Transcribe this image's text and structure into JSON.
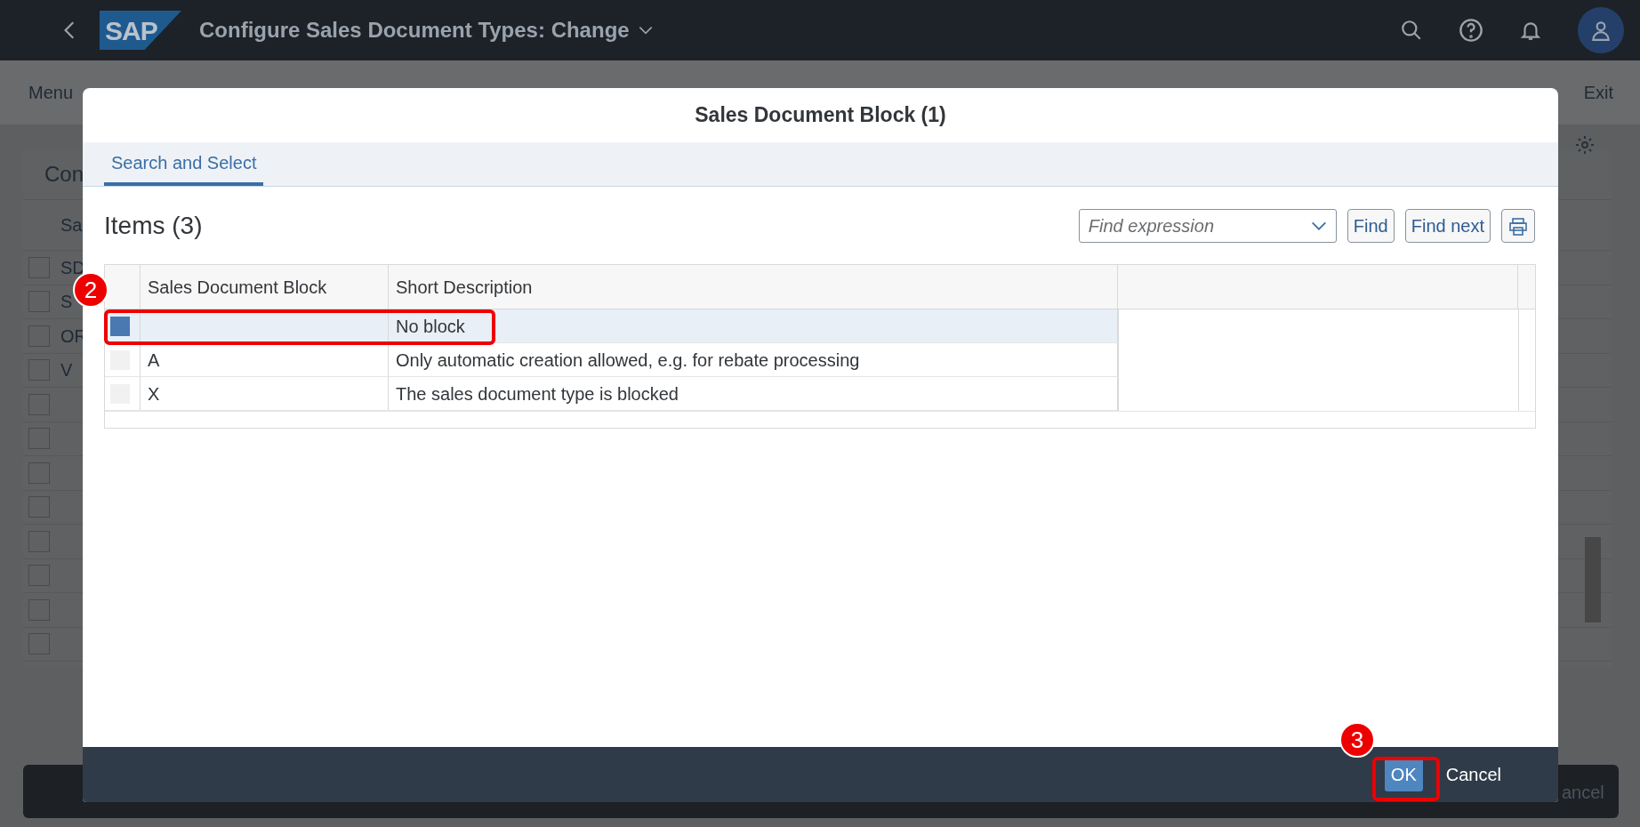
{
  "shell": {
    "logo": "SAP",
    "title": "Configure Sales Document Types: Change"
  },
  "background": {
    "menu": "Menu",
    "exit": "Exit",
    "section_title": "Con",
    "column_header": "Sa",
    "rows": [
      {
        "label": "SD",
        "checked": false
      },
      {
        "label": "S",
        "checked": false
      },
      {
        "label": "OR",
        "checked": false
      },
      {
        "label": "V",
        "checked": false
      },
      {
        "checked": false
      },
      {
        "checked": false
      },
      {
        "checked": false
      },
      {
        "checked": false
      },
      {
        "checked": false
      },
      {
        "checked": false
      },
      {
        "checked": false
      },
      {
        "checked": false
      }
    ],
    "footer_button": "ancel"
  },
  "dialog": {
    "title": "Sales Document Block (1)",
    "tabs": [
      {
        "label": "Search and Select",
        "selected": true
      }
    ],
    "items_title": "Items (3)",
    "find": {
      "placeholder": "Find expression"
    },
    "buttons": [
      "Find",
      "Find next"
    ],
    "columns": [
      "Sales Document Block",
      "Short Description"
    ],
    "rows": [
      {
        "description": "No block",
        "selected": true
      },
      {
        "block": "A",
        "description": "Only automatic creation allowed, e.g. for rebate processing",
        "selected": false
      },
      {
        "block": "X",
        "description": "The sales document type is blocked",
        "selected": false
      }
    ],
    "footer_buttons": [
      {
        "label": "OK",
        "kind": "emphasized"
      },
      {
        "label": "Cancel",
        "kind": "transparent"
      }
    ]
  },
  "annotations": [
    {
      "label": "2"
    },
    {
      "label": "3"
    }
  ]
}
